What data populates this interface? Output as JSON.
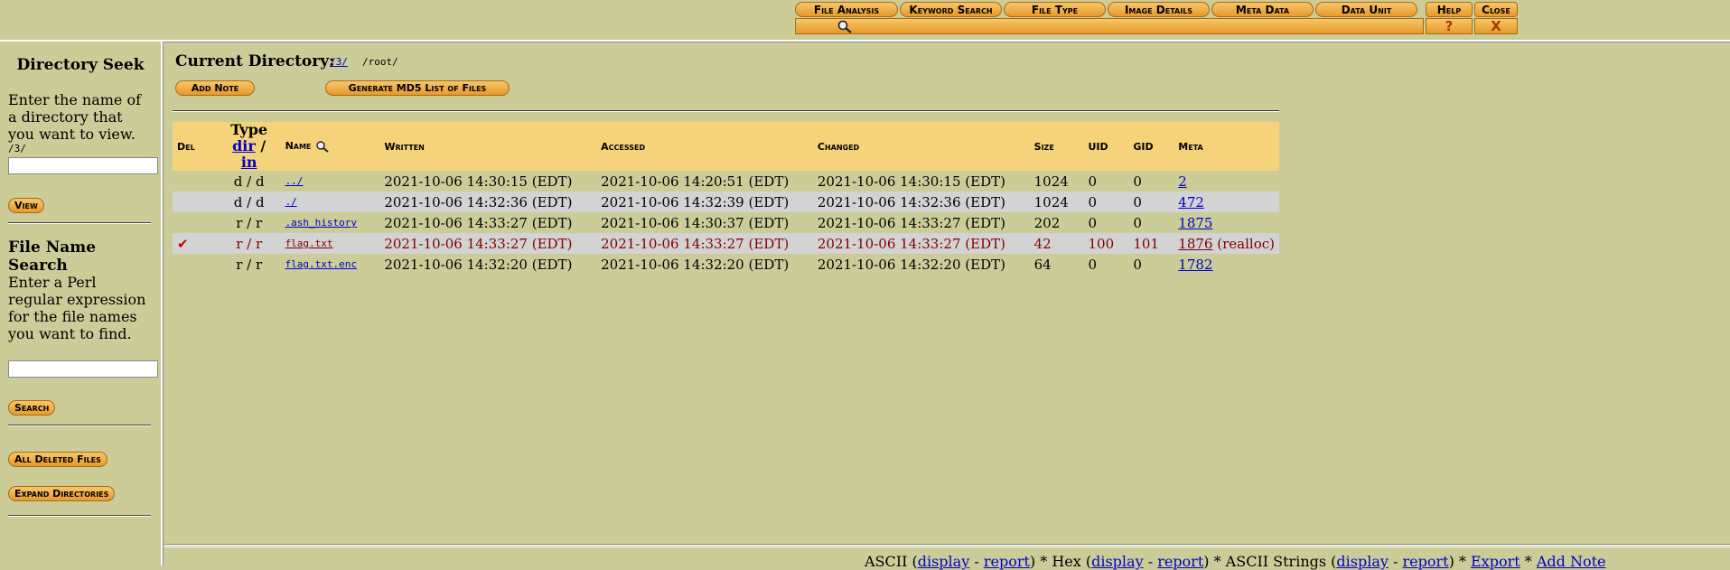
{
  "toolbar": {
    "tabs": [
      "File Analysis",
      "Keyword Search",
      "File Type",
      "Image Details",
      "Meta Data",
      "Data Unit",
      "Help",
      "Close"
    ],
    "help_symbol": "?",
    "close_symbol": "X"
  },
  "sidebar": {
    "dir_title": "Directory Seek",
    "dir_desc": "Enter the name of a directory that you want to view.",
    "dir_path": "/3/",
    "view_btn": "View",
    "file_title": "File Name Search",
    "file_desc": "Enter a Perl regular expression for the file names you want to find.",
    "search_btn": "Search",
    "deleted_btn": "All Deleted Files",
    "expand_btn": "Expand Directories"
  },
  "main": {
    "cur_label": "Current Directory:",
    "cur_link": "/3/",
    "cur_path": "/root/",
    "add_note": "Add Note",
    "gen_md5": "Generate MD5 List of Files",
    "headers": {
      "del": "Del",
      "type": "Type",
      "dir": "dir",
      "slash": "/",
      "in": "in",
      "name": "Name",
      "written": "Written",
      "accessed": "Accessed",
      "changed": "Changed",
      "size": "Size",
      "uid": "UID",
      "gid": "GID",
      "meta": "Meta"
    },
    "rows": [
      {
        "del": "",
        "type": "d / d",
        "name": "../",
        "written": "2021-10-06 14:30:15 (EDT)",
        "accessed": "2021-10-06 14:20:51 (EDT)",
        "changed": "2021-10-06 14:30:15 (EDT)",
        "size": "1024",
        "uid": "0",
        "gid": "0",
        "meta": "2",
        "extra": ""
      },
      {
        "del": "",
        "type": "d / d",
        "name": "./",
        "written": "2021-10-06 14:32:36 (EDT)",
        "accessed": "2021-10-06 14:32:39 (EDT)",
        "changed": "2021-10-06 14:32:36 (EDT)",
        "size": "1024",
        "uid": "0",
        "gid": "0",
        "meta": "472",
        "extra": ""
      },
      {
        "del": "",
        "type": "r / r",
        "name": ".ash_history",
        "written": "2021-10-06 14:33:27 (EDT)",
        "accessed": "2021-10-06 14:30:37 (EDT)",
        "changed": "2021-10-06 14:33:27 (EDT)",
        "size": "202",
        "uid": "0",
        "gid": "0",
        "meta": "1875",
        "extra": ""
      },
      {
        "del": "✔",
        "type": "r / r",
        "name": "flag.txt",
        "written": "2021-10-06 14:33:27 (EDT)",
        "accessed": "2021-10-06 14:33:27 (EDT)",
        "changed": "2021-10-06 14:33:27 (EDT)",
        "size": "42",
        "uid": "100",
        "gid": "101",
        "meta": "1876",
        "extra": "(realloc)"
      },
      {
        "del": "",
        "type": "r / r",
        "name": "flag.txt.enc",
        "written": "2021-10-06 14:32:20 (EDT)",
        "accessed": "2021-10-06 14:32:20 (EDT)",
        "changed": "2021-10-06 14:32:20 (EDT)",
        "size": "64",
        "uid": "0",
        "gid": "0",
        "meta": "1782",
        "extra": ""
      }
    ]
  },
  "bottom": {
    "ascii": "ASCII (",
    "display1": "display",
    "dash1": " - ",
    "report1": "report",
    "hex": ") * Hex (",
    "display2": "display",
    "dash2": " - ",
    "report2": "report",
    "strings": ") * ASCII Strings (",
    "display3": "display",
    "dash3": " - ",
    "report3": "report",
    "sep": ") * ",
    "export": "Export",
    "sep2": " * ",
    "addnote": "Add Note"
  }
}
